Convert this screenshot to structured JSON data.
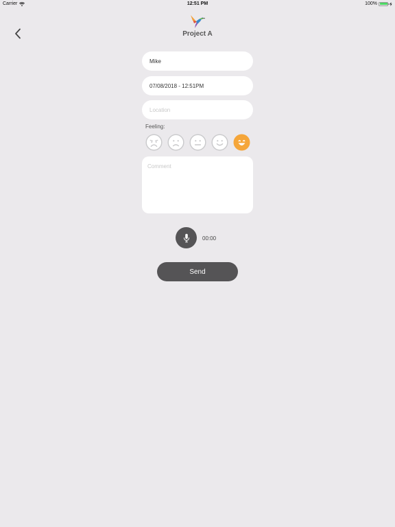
{
  "status_bar": {
    "carrier": "Carrier",
    "time": "12:51 PM",
    "battery": "100%",
    "battery_level": 1.0
  },
  "header": {
    "title": "Project A",
    "back_icon": "chevron-left-icon",
    "logo_icon": "hummingbird-logo"
  },
  "form": {
    "name_value": "Mike",
    "datetime_value": "07/08/2018 - 12:51PM",
    "location_placeholder": "Location",
    "feeling_label": "Feeling:",
    "feelings": [
      "very-sad",
      "sad",
      "neutral",
      "happy",
      "very-happy"
    ],
    "selected_feeling": "very-happy",
    "comment_placeholder": "Comment",
    "timer": "00:00",
    "send_label": "Send"
  },
  "colors": {
    "background": "#ebe9ec",
    "button": "#555456",
    "selected_feeling": "#f5a63a",
    "feeling_outline": "#c9c9cb",
    "battery": "#4cd964"
  }
}
